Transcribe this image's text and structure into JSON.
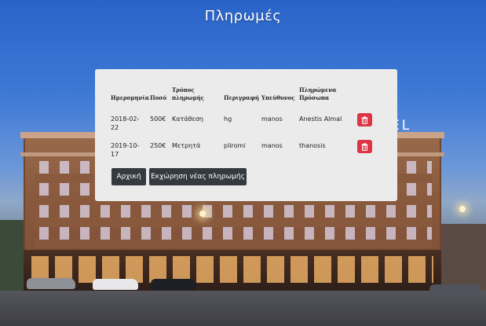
{
  "page": {
    "title": "Πληρωμές"
  },
  "background": {
    "sign_text": "EL"
  },
  "table": {
    "headers": {
      "date": "Ημερομηνία",
      "amount": "Ποσό",
      "method_line1": "Τρόπος",
      "method_line2": "πληρωμής",
      "description": "Περιγραφή",
      "responsible": "Υπεύθυνος",
      "people_line1": "Πληρώμενα",
      "people_line2": "Πρόσωπα"
    },
    "rows": [
      {
        "date_line1": "2018-02-",
        "date_line2": "22",
        "amount": "500€",
        "method": "Κατάθεση",
        "description": "hg",
        "responsible": "manos",
        "people": "Anestis Almal"
      },
      {
        "date_line1": "2019-10-",
        "date_line2": "17",
        "amount": "250€",
        "method": "Μετρητά",
        "description": "pliromi",
        "responsible": "manos",
        "people": "thanosis"
      }
    ],
    "delete_icon": "trash-icon"
  },
  "actions": {
    "home_label": "Αρχική",
    "new_payment_label": "Εκχώρηση νέας πληρωμής"
  },
  "colors": {
    "danger": "#dc3545",
    "dark_button": "#343a40",
    "card_bg": "#ebebeb"
  }
}
